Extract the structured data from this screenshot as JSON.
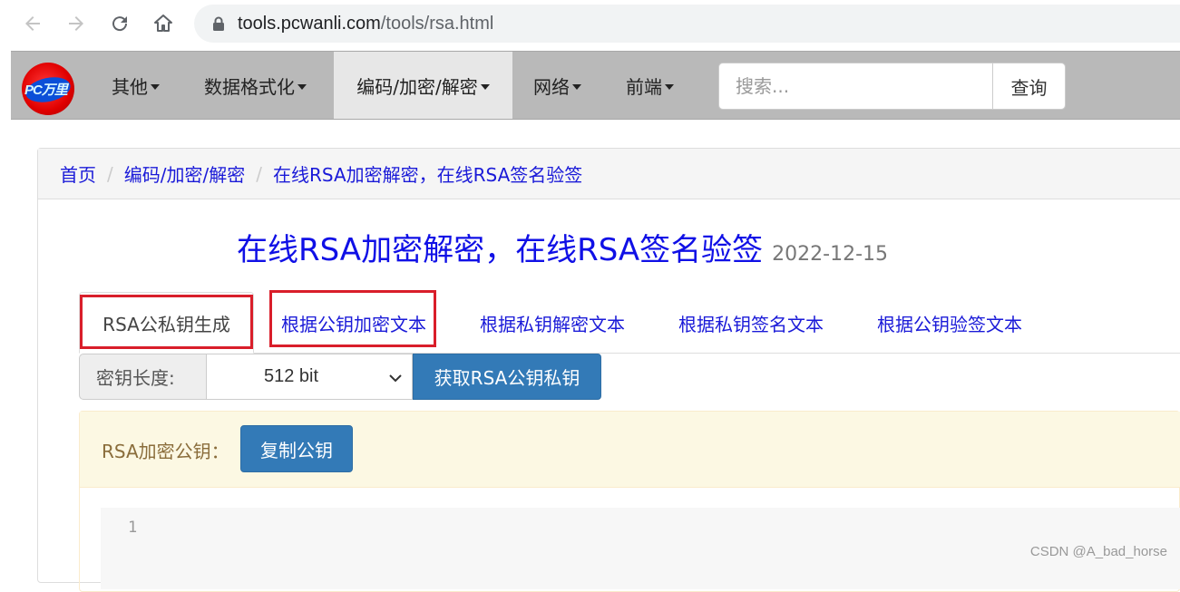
{
  "browser": {
    "url_domain": "tools.pcwanli.com",
    "url_path": "/tools/rsa.html"
  },
  "navbar": {
    "logo_text": "PC万里",
    "menu": [
      {
        "label": "其他"
      },
      {
        "label": "数据格式化"
      },
      {
        "label": "编码/加密/解密"
      },
      {
        "label": "网络"
      },
      {
        "label": "前端"
      }
    ],
    "search_placeholder": "搜索...",
    "search_button": "查询"
  },
  "breadcrumb": [
    {
      "label": "首页"
    },
    {
      "label": "编码/加密/解密"
    },
    {
      "label": "在线RSA加密解密，在线RSA签名验签"
    }
  ],
  "page": {
    "title": "在线RSA加密解密，在线RSA签名验签",
    "date": "2022-12-15"
  },
  "tabs": [
    {
      "label": "RSA公私钥生成"
    },
    {
      "label": "根据公钥加密文本"
    },
    {
      "label": "根据私钥解密文本"
    },
    {
      "label": "根据私钥签名文本"
    },
    {
      "label": "根据公钥验签文本"
    }
  ],
  "keygen": {
    "label": "密钥长度:",
    "selected": "512 bit",
    "generate_button": "获取RSA公钥私钥"
  },
  "public_key": {
    "label": "RSA加密公钥：",
    "copy_button": "复制公钥",
    "line_number": "1"
  },
  "watermark": "CSDN @A_bad_horse"
}
